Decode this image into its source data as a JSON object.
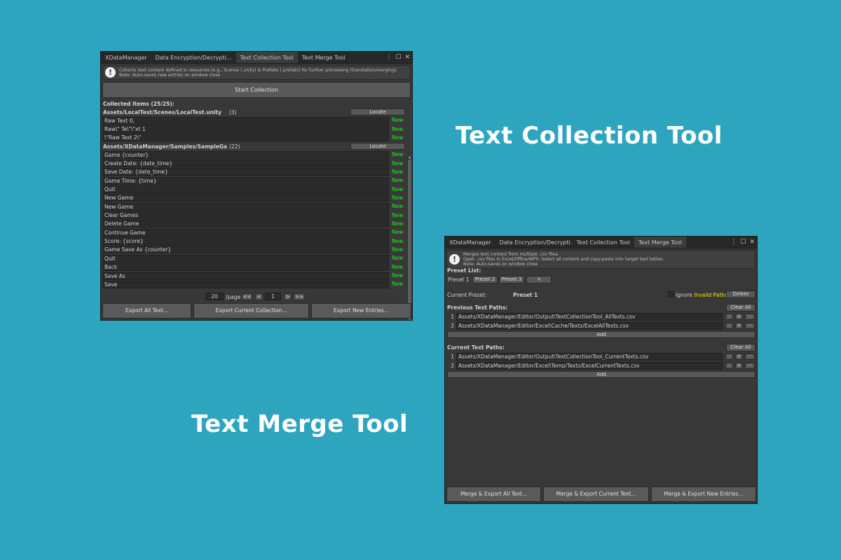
{
  "headings": {
    "collection": "Text Collection Tool",
    "merge": "Text Merge Tool"
  },
  "collection_window": {
    "tabs": [
      "XDataManager",
      "Data Encryption/Decrypti...",
      "Text Collection Tool",
      "Text Merge Tool"
    ],
    "active_tab": 2,
    "help": {
      "line1": "Collects text content defined in resources (e.g., Scenes (.unity) & Prefabs (.prefab)) for further processing (translation/merging).",
      "line2": "Note: Auto-saves new entries on window close"
    },
    "start_button": "Start Collection",
    "collected_label": "Collected Items (25/25):",
    "locate_label": "Locate",
    "groups": [
      {
        "path": "Assets/LocalTest/Scenes/LocalTest.unity",
        "count": "(3)",
        "entries": [
          {
            "text": "Raw Text 0,",
            "status": "New"
          },
          {
            "text": "Raw\\\" Te\\\"\\\"xt 1",
            "status": "New"
          },
          {
            "text": "\\\"Raw Text 2\\\"",
            "status": "New"
          }
        ]
      },
      {
        "path": "Assets/XDataManager/Samples/SampleGame/Scenes/SampleGame.unity",
        "count": "(22)",
        "entries": [
          {
            "text": "Game {counter}",
            "status": "New"
          },
          {
            "text": "Create Date: {date_time}",
            "status": "New"
          },
          {
            "text": "Save Date: {date_time}",
            "status": "New"
          },
          {
            "text": "Game Time: {time}",
            "status": "New"
          },
          {
            "text": "Quit",
            "status": "New"
          },
          {
            "text": "New Game",
            "status": "New"
          },
          {
            "text": "New Game",
            "status": "New"
          },
          {
            "text": "Clear Games",
            "status": "New"
          },
          {
            "text": "Delete Game",
            "status": "New"
          },
          {
            "text": "Continue Game",
            "status": "New"
          },
          {
            "text": "Score: {score}",
            "status": "New"
          },
          {
            "text": "Game Save As {counter}",
            "status": "New"
          },
          {
            "text": "Quit",
            "status": "New"
          },
          {
            "text": "Back",
            "status": "New"
          },
          {
            "text": "Save As",
            "status": "New"
          },
          {
            "text": "Save",
            "status": "New"
          }
        ]
      }
    ],
    "pager": {
      "per_page": "20",
      "per_page_label": "/page",
      "first": "<<",
      "prev": "<",
      "page": "1",
      "next": ">",
      "last": ">>"
    },
    "bottom_buttons": [
      "Export All Text...",
      "Export Current Collection...",
      "Export New Entries..."
    ]
  },
  "merge_window": {
    "tabs": [
      "XDataManager",
      "Data Encryption/Decrypti...",
      "Text Collection Tool",
      "Text Merge Tool"
    ],
    "active_tab": 3,
    "help": {
      "line1": "Merges text content from multiple .csv files.",
      "line2": "Open .csv files in Excel/Office/WPS: Select all content and copy-paste into target text tables.",
      "line3": "Note: Auto-saves on window close"
    },
    "preset_list_label": "Preset List:",
    "presets": [
      "Preset 1",
      "Preset 2",
      "Preset 3"
    ],
    "preset_add": "+",
    "current_preset_label": "Current Preset:",
    "current_preset_value": "Preset 1",
    "ignore_label": "Ignore",
    "invalid_paths_label": "Invalid Paths",
    "delete_label": "Delete",
    "previous_label": "Previous Text Paths:",
    "previous_paths": [
      {
        "index": "1",
        "path": "Assets/XDataManager/Editor/Output\\TextCollectionTool_AllTexts.csv"
      },
      {
        "index": "2",
        "path": "Assets/XDataManager/Editor/Excel\\Cache/Texts/ExcelAllTexts.csv"
      }
    ],
    "current_label": "Current Text Paths:",
    "current_paths": [
      {
        "index": "1",
        "path": "Assets/XDataManager/Editor/Output\\TextCollectionTool_CurrentTexts.csv"
      },
      {
        "index": "2",
        "path": "Assets/XDataManager/Editor/Excel\\Temp/Texts/ExcelCurrentTexts.csv"
      }
    ],
    "clear_all_label": "Clear All",
    "add_label": "Add",
    "row_buttons": [
      "-",
      "+",
      "···"
    ],
    "bottom_buttons": [
      "Merge & Export All Text...",
      "Merge & Export Current Text...",
      "Merge & Export New Entries..."
    ]
  },
  "colors": {
    "background": "#2ea5bf",
    "new_status": "#26e526",
    "invalid_paths": "#f2e800"
  }
}
